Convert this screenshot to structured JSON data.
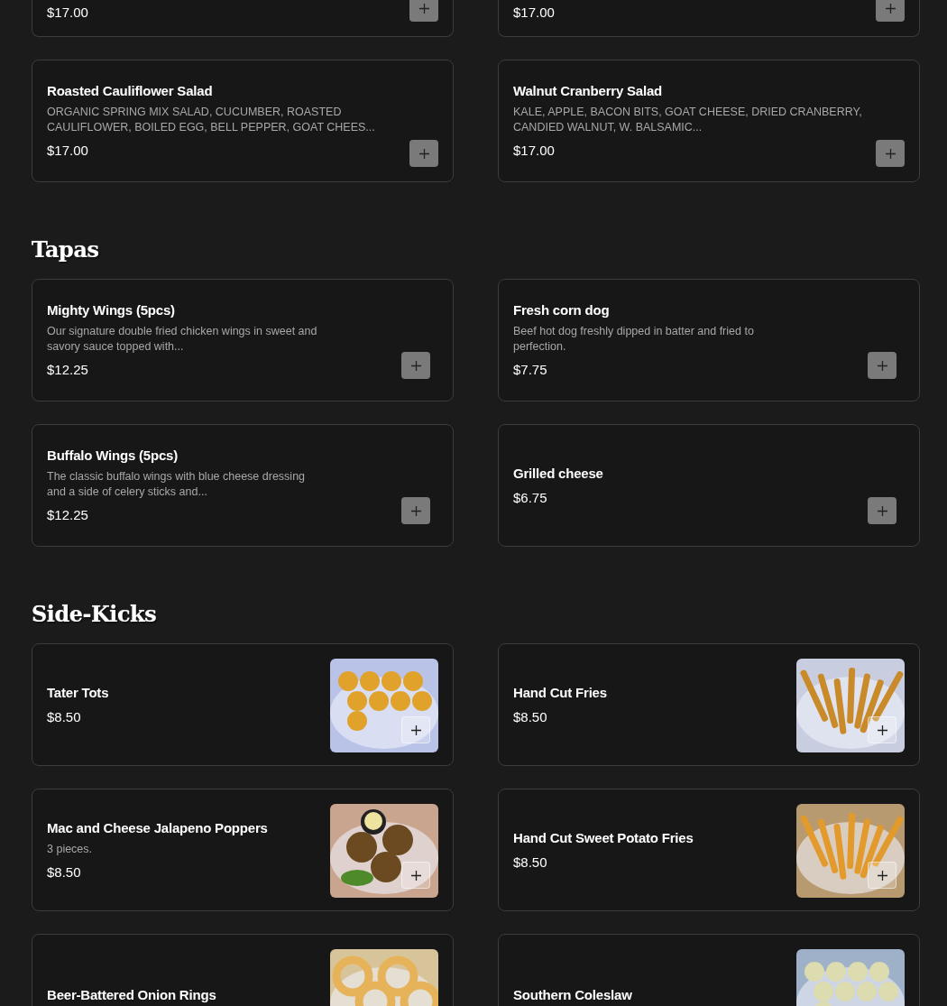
{
  "sections": [
    {
      "items": [
        {
          "price": "$17.00"
        },
        {
          "price": "$17.00"
        },
        {
          "name": "Roasted Cauliflower Salad",
          "description": "ORGANIC SPRING MIX SALAD, CUCUMBER, ROASTED CAULIFLOWER, BOILED EGG, BELL PEPPER, GOAT CHEES...",
          "price": "$17.00"
        },
        {
          "name": "Walnut Cranberry Salad",
          "description": "KALE, APPLE, BACON BITS, GOAT CHEESE, DRIED CRANBERRY, CANDIED WALNUT, W. BALSAMIC...",
          "price": "$17.00"
        }
      ]
    },
    {
      "title": "Tapas",
      "items": [
        {
          "name": "Mighty Wings (5pcs)",
          "description": "Our signature double fried chicken wings in sweet and savory sauce topped with...",
          "price": "$12.25"
        },
        {
          "name": "Fresh corn dog",
          "description": "Beef hot dog freshly dipped in batter and fried to perfection.",
          "price": "$7.75"
        },
        {
          "name": "Buffalo Wings (5pcs)",
          "description": "The classic buffalo wings with blue cheese dressing and a side of celery sticks and...",
          "price": "$12.25"
        },
        {
          "name": "Grilled cheese",
          "price": "$6.75"
        }
      ]
    },
    {
      "title": "Side-Kicks",
      "items": [
        {
          "name": "Tater Tots",
          "price": "$8.50"
        },
        {
          "name": "Hand Cut Fries",
          "price": "$8.50"
        },
        {
          "name": "Mac and Cheese Jalapeno Poppers",
          "description": "3 pieces.",
          "price": "$8.50"
        },
        {
          "name": "Hand Cut Sweet Potato Fries",
          "price": "$8.50"
        },
        {
          "name": "Beer-Battered Onion Rings"
        },
        {
          "name": "Southern Coleslaw"
        }
      ]
    }
  ]
}
